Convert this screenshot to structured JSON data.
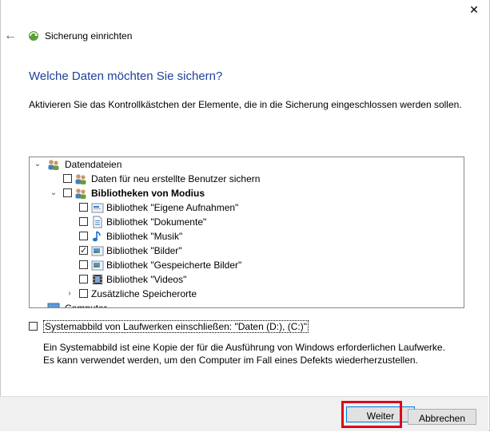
{
  "window": {
    "title": "Sicherung einrichten"
  },
  "page": {
    "heading": "Welche Daten möchten Sie sichern?",
    "instruction": "Aktivieren Sie das Kontrollkästchen der Elemente, die in die Sicherung eingeschlossen werden sollen."
  },
  "tree": {
    "items": [
      {
        "label": "Datendateien",
        "level": 0,
        "expanded": true,
        "checked": null,
        "icon": "users-icon"
      },
      {
        "label": "Daten für neu erstellte Benutzer sichern",
        "level": 1,
        "checked": false,
        "icon": "users-icon"
      },
      {
        "label": "Bibliotheken von Modius",
        "level": 1,
        "expanded": true,
        "checked": false,
        "icon": "users-icon",
        "bold": true
      },
      {
        "label": "Bibliothek \"Eigene Aufnahmen\"",
        "level": 2,
        "checked": false,
        "icon": "library-icon"
      },
      {
        "label": "Bibliothek \"Dokumente\"",
        "level": 2,
        "checked": false,
        "icon": "document-icon"
      },
      {
        "label": "Bibliothek \"Musik\"",
        "level": 2,
        "checked": false,
        "icon": "music-icon"
      },
      {
        "label": "Bibliothek \"Bilder\"",
        "level": 2,
        "checked": true,
        "icon": "pictures-icon"
      },
      {
        "label": "Bibliothek \"Gespeicherte Bilder\"",
        "level": 2,
        "checked": false,
        "icon": "pictures-icon"
      },
      {
        "label": "Bibliothek \"Videos\"",
        "level": 2,
        "checked": false,
        "icon": "video-icon"
      },
      {
        "label": "Zusätzliche Speicherorte",
        "level": 2,
        "expanded": false,
        "checked": false,
        "icon": "folder-icon"
      },
      {
        "label": "Computer",
        "level": 0,
        "expanded": false,
        "checked": null,
        "icon": "computer-icon"
      }
    ]
  },
  "system_image": {
    "label": "Systemabbild von Laufwerken einschließen: \"Daten (D:), (C:)\"",
    "checked": false,
    "description": "Ein Systemabbild ist eine Kopie der für die Ausführung von Windows erforderlichen Laufwerke. Es kann verwendet werden, um den Computer im Fall eines Defekts wiederherzustellen."
  },
  "buttons": {
    "next": "Weiter",
    "cancel": "Abbrechen"
  },
  "colors": {
    "heading": "#1f3f9a",
    "highlight": "#e0001a"
  }
}
